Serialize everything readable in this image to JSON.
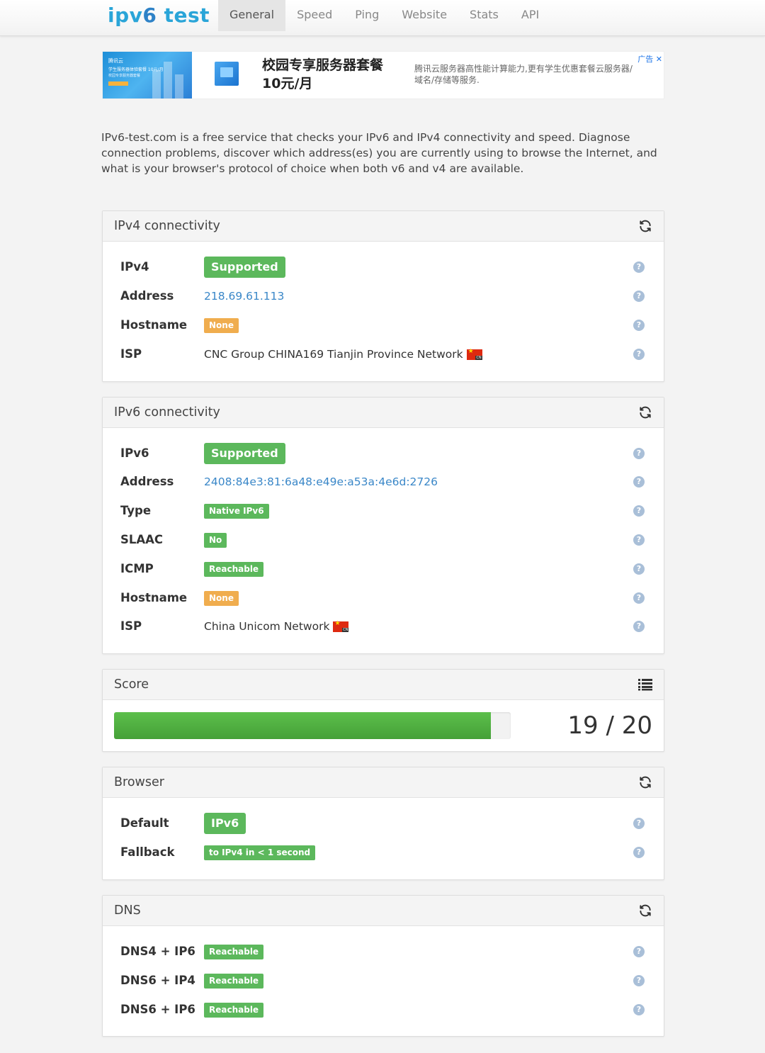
{
  "nav": {
    "brand_prefix": "ipv",
    "brand_six": "6",
    "brand_suffix": " test",
    "items": [
      "General",
      "Speed",
      "Ping",
      "Website",
      "Stats",
      "API"
    ],
    "active": "General"
  },
  "ad": {
    "image_line1": "腾讯云",
    "image_line2": "学生服务器体验套餐 10元/月",
    "image_line3": "校园专享服务器套餐",
    "title": "校园专享服务器套餐 10元/月",
    "description": "腾讯云服务器高性能计算能力,更有学生优惠套餐云服务器/域名/存储等服务.",
    "tag": "广告 ✕"
  },
  "intro": "IPv6-test.com is a free service that checks your IPv6 and IPv4 connectivity and speed. Diagnose connection problems, discover which address(es) you are currently using to browse the Internet, and what is your browser's protocol of choice when both v6 and v4 are available.",
  "ipv4": {
    "title": "IPv4 connectivity",
    "rows": [
      {
        "label": "IPv4",
        "value": "Supported"
      },
      {
        "label": "Address",
        "value": "218.69.61.113"
      },
      {
        "label": "Hostname",
        "value": "None"
      },
      {
        "label": "ISP",
        "value": "CNC Group CHINA169 Tianjin Province Network"
      }
    ]
  },
  "ipv6": {
    "title": "IPv6 connectivity",
    "rows": [
      {
        "label": "IPv6",
        "value": "Supported"
      },
      {
        "label": "Address",
        "value": "2408:84e3:81:6a48:e49e:a53a:4e6d:2726"
      },
      {
        "label": "Type",
        "value": "Native IPv6"
      },
      {
        "label": "SLAAC",
        "value": "No"
      },
      {
        "label": "ICMP",
        "value": "Reachable"
      },
      {
        "label": "Hostname",
        "value": "None"
      },
      {
        "label": "ISP",
        "value": "China Unicom Network"
      }
    ]
  },
  "score": {
    "title": "Score",
    "value": 19,
    "max": 20,
    "text": "19 / 20"
  },
  "browser": {
    "title": "Browser",
    "rows": [
      {
        "label": "Default",
        "value": "IPv6"
      },
      {
        "label": "Fallback",
        "value": "to IPv4 in < 1 second"
      }
    ]
  },
  "dns": {
    "title": "DNS",
    "rows": [
      {
        "label": "DNS4 + IP6",
        "value": "Reachable"
      },
      {
        "label": "DNS6 + IP4",
        "value": "Reachable"
      },
      {
        "label": "DNS6 + IP6",
        "value": "Reachable"
      }
    ]
  },
  "help_glyph": "?",
  "flag": {
    "star": "★",
    "code": "CN"
  },
  "colors": {
    "success": "#5cb85c",
    "warning": "#f0ad4e",
    "link": "#3a87c8",
    "brand": "#2aa5d8",
    "help": "#a9bfd8"
  }
}
